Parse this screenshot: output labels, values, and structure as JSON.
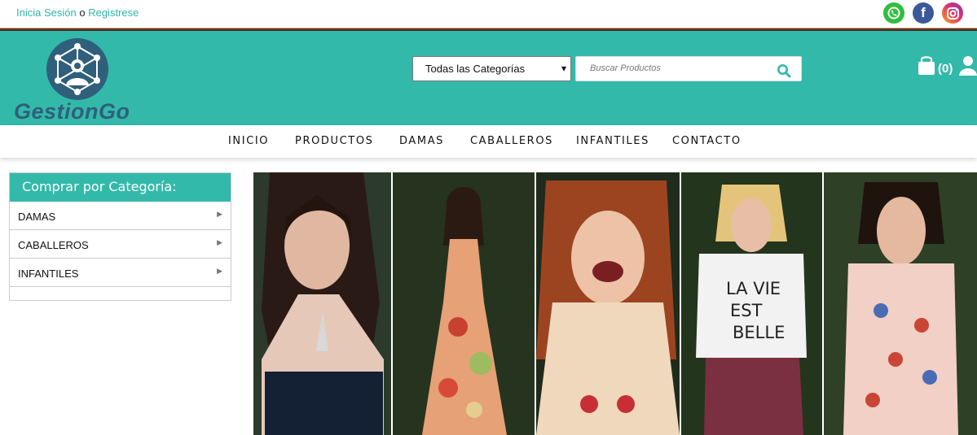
{
  "auth": {
    "login": "Inicia Sesión",
    "or": "o",
    "register": "Registrese"
  },
  "social": {
    "whatsapp": "whatsapp-icon",
    "facebook": "f",
    "instagram": "instagram-icon"
  },
  "brand": {
    "name": "GestionGo",
    "logo": "network-person-logo"
  },
  "search": {
    "category": "Todas las Categorías",
    "placeholder": "Buscar Productos"
  },
  "cart": {
    "count": "(0)"
  },
  "nav": {
    "items": [
      "INICIO",
      "PRODUCTOS",
      "DAMAS",
      "CABALLEROS",
      "INFANTILES",
      "CONTACTO"
    ]
  },
  "categories": {
    "title": "Comprar por Categoría:",
    "items": [
      "DAMAS",
      "CABALLEROS",
      "INFANTILES"
    ]
  },
  "colors": {
    "accent": "#33b9a9",
    "brand": "#2f5f7b",
    "link": "#2db8a8"
  }
}
